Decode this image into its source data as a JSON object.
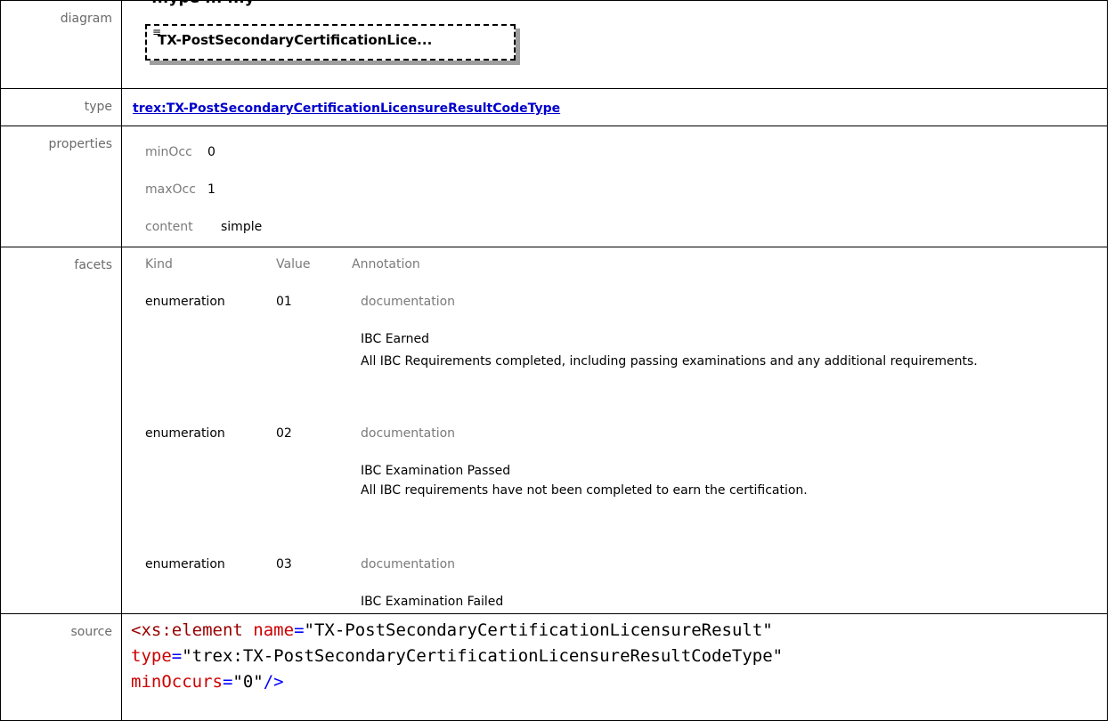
{
  "header": {
    "title": "...ype ... ...y"
  },
  "rows": {
    "diagram": {
      "label": "diagram",
      "box_text": "TX-PostSecondaryCertificationLice...",
      "icon": "list-icon"
    },
    "type": {
      "label": "type",
      "link": "trex:TX-PostSecondaryCertificationLicensureResultCodeType"
    },
    "properties": {
      "label": "properties",
      "items": [
        {
          "key": "minOcc",
          "value": "0"
        },
        {
          "key": "maxOcc",
          "value": "1"
        },
        {
          "key": "content",
          "value": "simple"
        }
      ]
    },
    "facets": {
      "label": "facets",
      "headers": [
        "Kind",
        "Value",
        "Annotation"
      ],
      "entries": [
        {
          "kind": "enumeration",
          "value": "01",
          "doc_label": "documentation",
          "doc_title": "IBC Earned",
          "doc_text": "All IBC Requirements completed, including passing examinations and any additional requirements."
        },
        {
          "kind": "enumeration",
          "value": "02",
          "doc_label": "documentation",
          "doc_title": "IBC Examination Passed",
          "doc_text": "All IBC requirements have not been completed to earn the certification."
        },
        {
          "kind": "enumeration",
          "value": "03",
          "doc_label": "documentation",
          "doc_title": "IBC Examination Failed",
          "doc_text": ""
        }
      ]
    },
    "source": {
      "label": "source",
      "line1_tag": "<xs:element",
      "line1_attr": "name",
      "line1_val": "\"TX-PostSecondaryCertificationLicensureResult\"",
      "line2_attr": "type",
      "line2_val": "\"trex:TX-PostSecondaryCertificationLicensureResultCodeType\"",
      "line3_attr": "minOccurs",
      "line3_val": "\"0\"",
      "line3_end": "/>"
    }
  }
}
